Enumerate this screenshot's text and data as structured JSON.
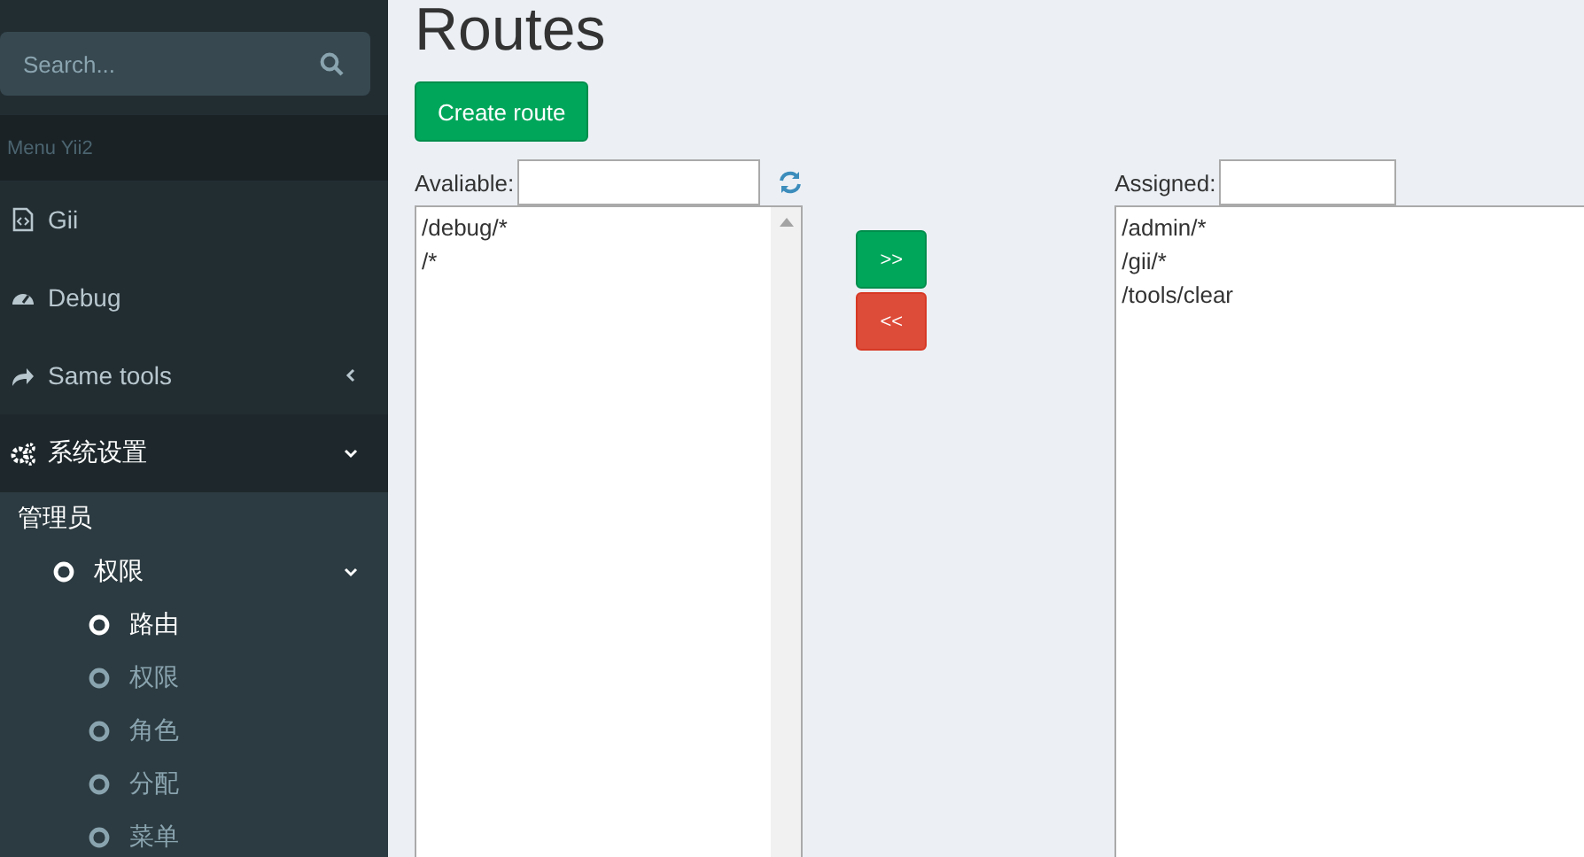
{
  "sidebar": {
    "search": {
      "placeholder": "Search..."
    },
    "header": "Menu Yii2",
    "items": [
      {
        "label": "Gii",
        "kind": "file",
        "selected": false
      },
      {
        "label": "Debug",
        "kind": "gauge",
        "selected": false
      },
      {
        "label": "Same tools",
        "kind": "share",
        "expanded": false,
        "selected": false
      },
      {
        "label": "系统设置",
        "kind": "gears",
        "expanded": true,
        "selected": true,
        "children": [
          {
            "label": "管理员",
            "kind": "header"
          },
          {
            "label": "权限",
            "kind": "link",
            "expanded": true,
            "children": [
              {
                "label": "路由",
                "selected": true
              },
              {
                "label": "权限",
                "selected": false
              },
              {
                "label": "角色",
                "selected": false
              },
              {
                "label": "分配",
                "selected": false
              },
              {
                "label": "菜单",
                "selected": false
              }
            ]
          }
        ]
      }
    ]
  },
  "page": {
    "title": "Routes",
    "create_button": "Create route",
    "available": {
      "label": "Avaliable:",
      "routes": [
        "/debug/*",
        "/*"
      ]
    },
    "buttons": [
      {
        "label": ">>",
        "kind": "assign"
      },
      {
        "label": "<<",
        "kind": "remove"
      }
    ],
    "assigned": {
      "label": "Assigned:",
      "routes": [
        "/admin/*",
        "/gii/*",
        "/tools/clear"
      ]
    }
  }
}
